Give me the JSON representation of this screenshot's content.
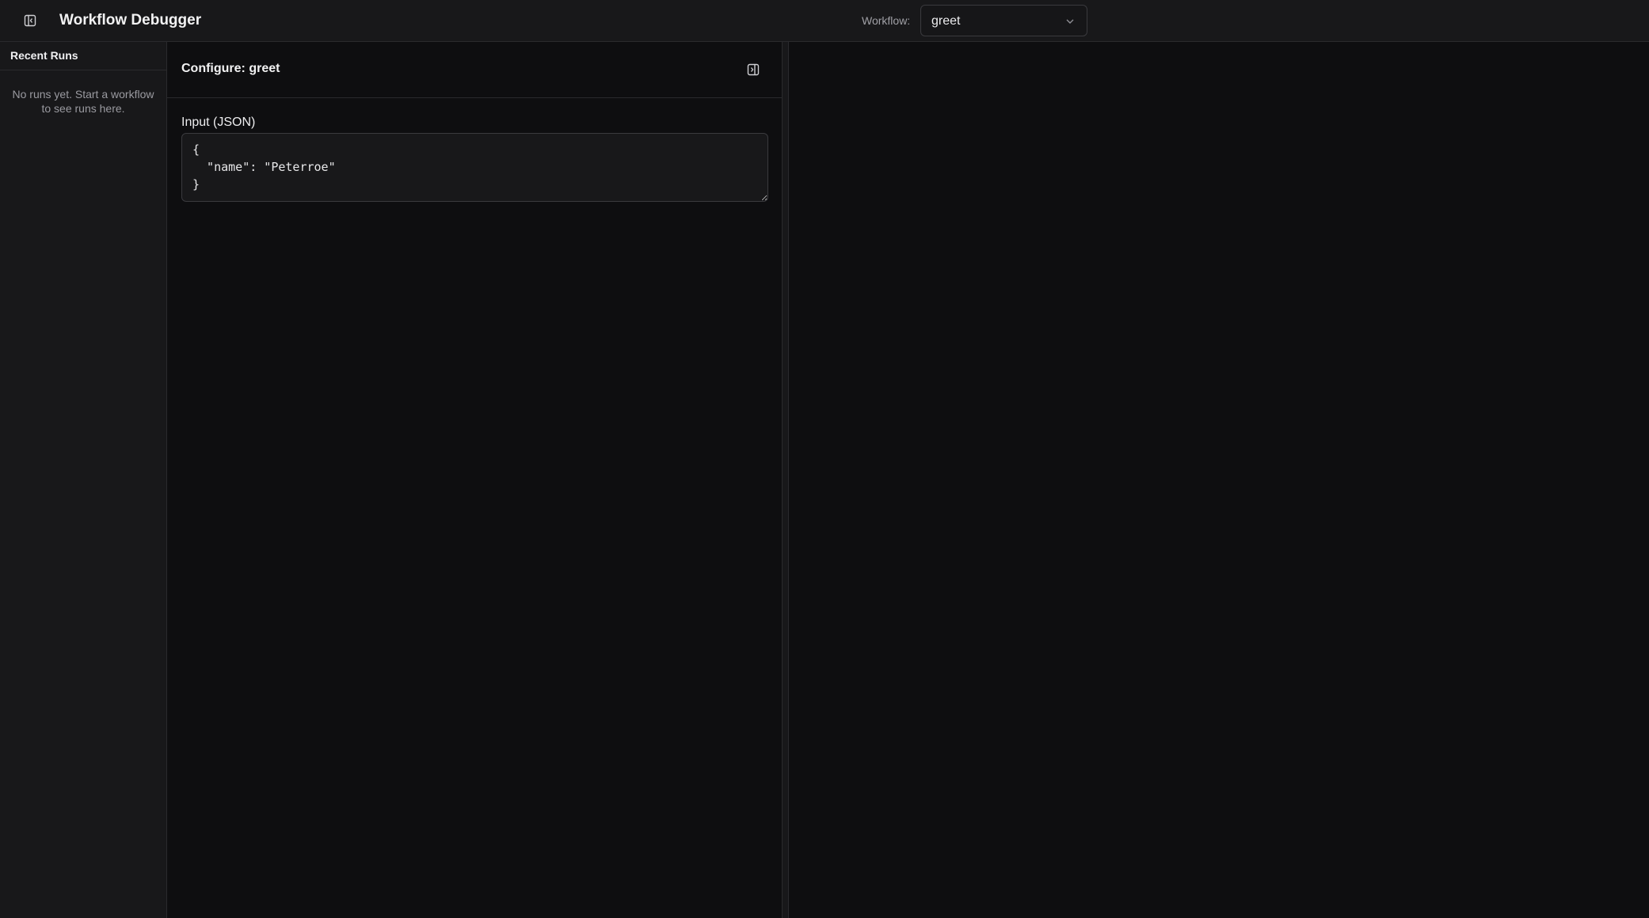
{
  "header": {
    "title": "Workflow Debugger",
    "workflow_label": "Workflow:",
    "workflow_selected": "greet",
    "sidebar_toggle_icon": "panel-left-icon",
    "dropdown_icon": "chevron-down-icon"
  },
  "sidebar": {
    "title": "Recent Runs",
    "empty_message": "No runs yet. Start a workflow to see runs here."
  },
  "config": {
    "title": "Configure: greet",
    "collapse_icon": "panel-right-icon",
    "input_label": "Input (JSON)",
    "input_value": "{\n  \"name\": \"Peterroe\"\n}"
  },
  "colors": {
    "background": "#0e0e10",
    "panel": "#18181a",
    "border": "#2a2a2d",
    "text": "#e8e8ea",
    "muted_text": "#9a9aa0"
  }
}
